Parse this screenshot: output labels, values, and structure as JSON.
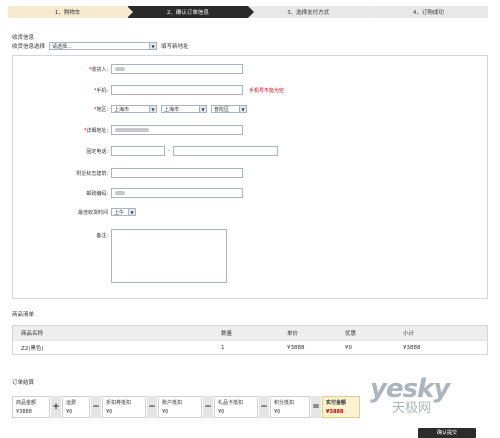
{
  "steps": [
    {
      "label": "1、购物车"
    },
    {
      "label": "2、确认订单信息"
    },
    {
      "label": "3、选择支付方式"
    },
    {
      "label": "4、订购成功"
    }
  ],
  "shipping": {
    "section_title": "收货信息",
    "select_label": "收货信息选择",
    "select_value": "请选择...",
    "new_address_link": "填写新地址"
  },
  "form": {
    "receiver_label": "收货人:",
    "mobile_label": "手机:",
    "mobile_error": "手机号不能为空",
    "region_label": "地区:",
    "province": "上海市",
    "city": "上海市",
    "district": "普陀区",
    "address_label": "详细地址:",
    "phone_label": "固定电话:",
    "phone_sep": "-",
    "landmark_label": "附近标志建筑:",
    "zip_label": "邮政编码:",
    "time_label": "最佳收货时间",
    "time_value": "上午",
    "note_label": "备注:",
    "required_mark": "*"
  },
  "goods": {
    "title": "商品清单",
    "headers": [
      "商品名称",
      "数量",
      "单价",
      "优惠",
      "小计"
    ],
    "rows": [
      {
        "name": "Z2(黑色)",
        "qty": "1",
        "price": "¥3888",
        "discount": "¥0",
        "subtotal": "¥3888"
      }
    ]
  },
  "settle": {
    "title": "订单结算",
    "items": [
      {
        "label": "商品金额",
        "value": "¥3888"
      },
      {
        "label": "运费",
        "value": "¥0"
      },
      {
        "label": "折扣券抵扣",
        "value": "¥0"
      },
      {
        "label": "账户抵扣",
        "value": "¥0"
      },
      {
        "label": "礼品卡抵扣",
        "value": "¥0"
      },
      {
        "label": "积分抵扣",
        "value": "¥0"
      },
      {
        "label": "实付金额",
        "value": "¥3888"
      }
    ],
    "ops": [
      "+",
      "−",
      "−",
      "−",
      "−",
      "="
    ]
  },
  "watermark": {
    "top": "yesky",
    "bottom": "天极网"
  },
  "confirm_button": "确认提交",
  "colors": {
    "error": "#dd0000",
    "active_step": "#2b2b2b",
    "first_step": "#f5e9cf"
  }
}
